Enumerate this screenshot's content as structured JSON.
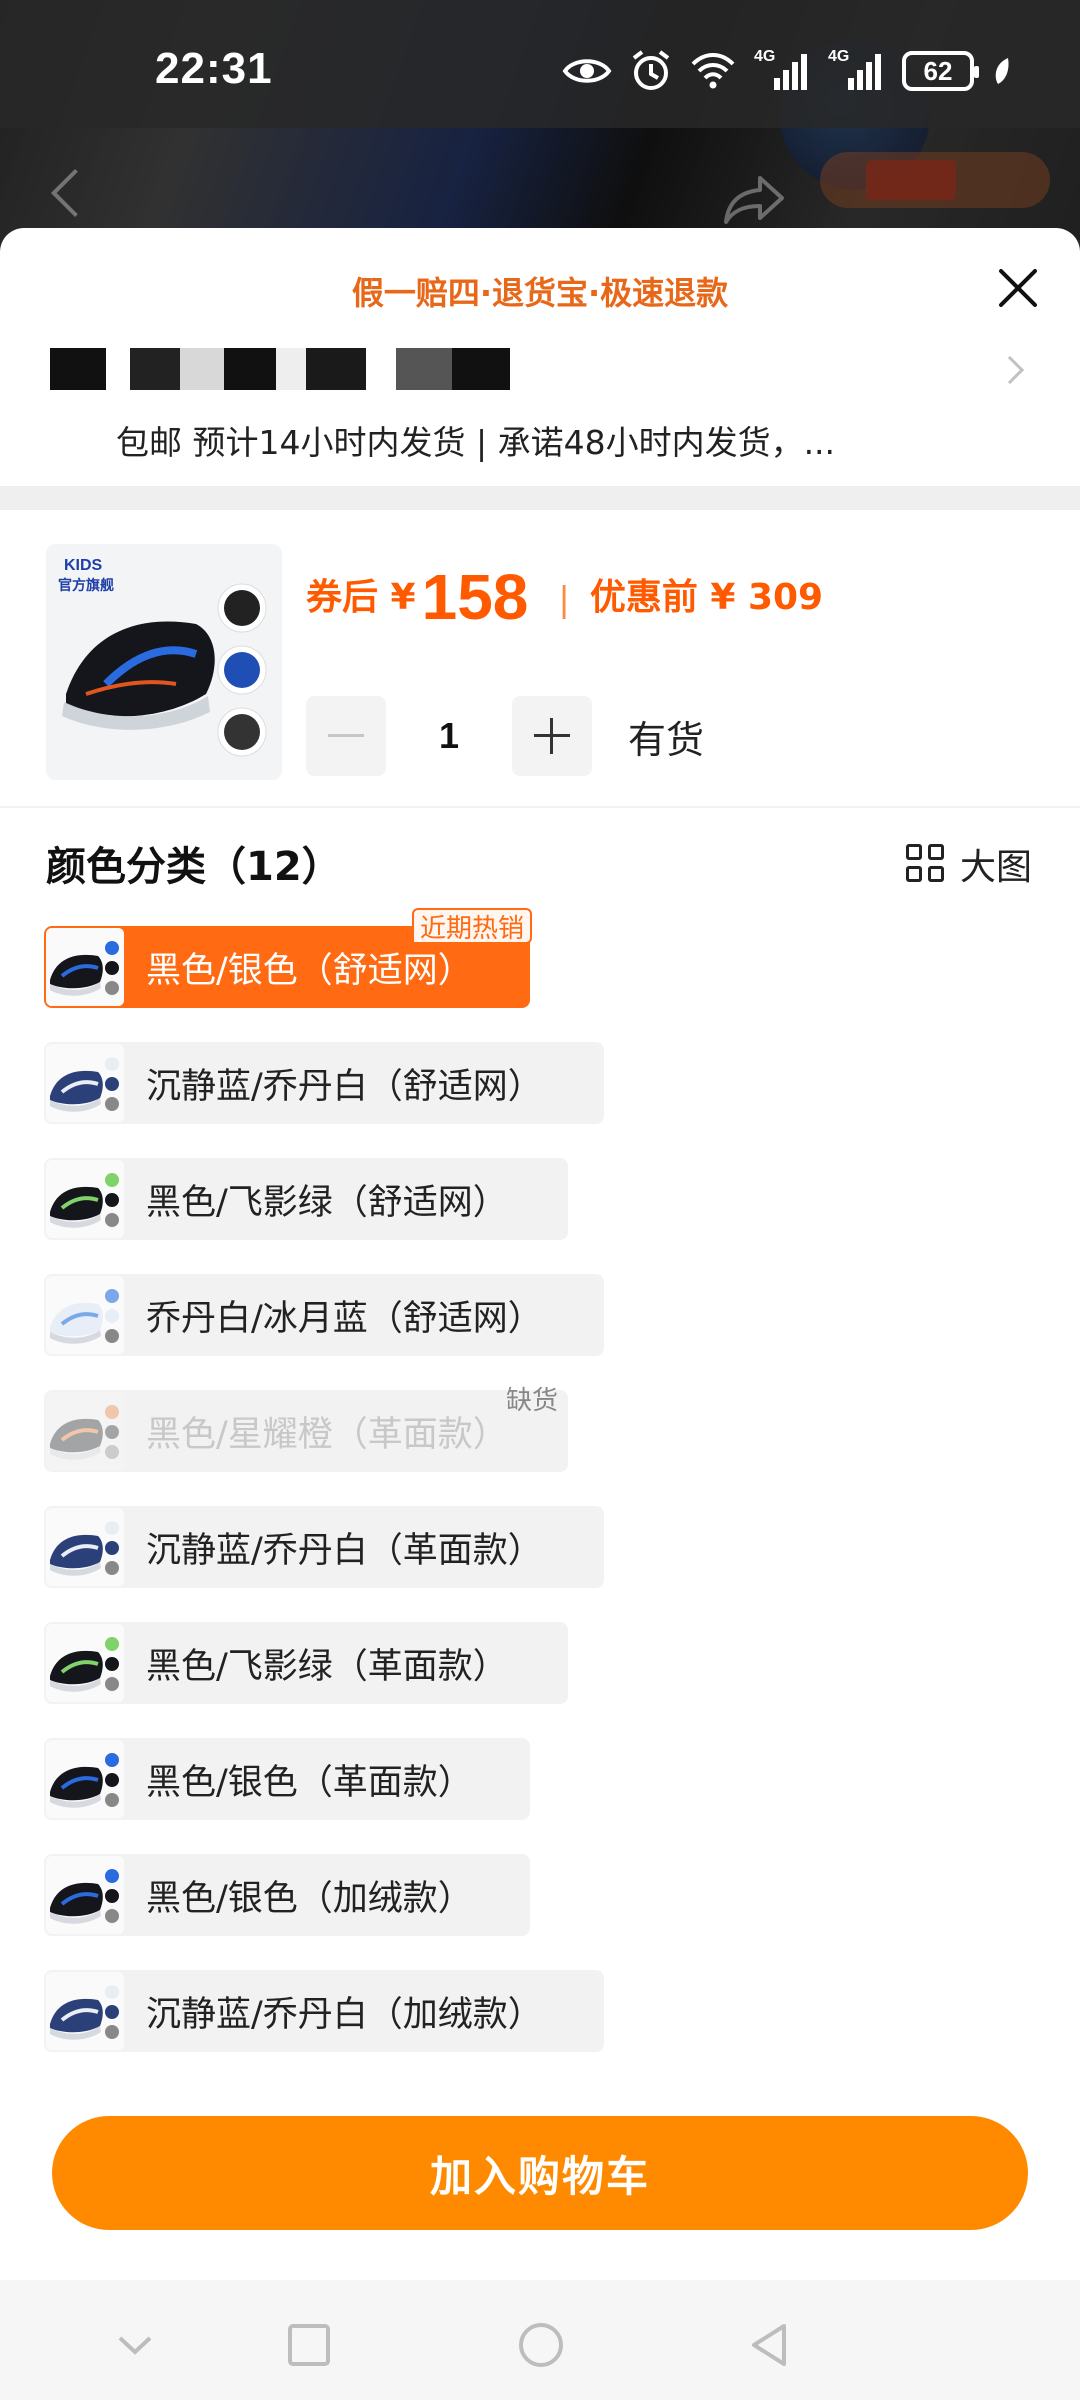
{
  "status_bar": {
    "time": "22:31",
    "battery": "62",
    "signal_1": "4G",
    "signal_2": "4G"
  },
  "sheet": {
    "guarantee_text": "假一赔四·退货宝·极速退款",
    "shipping_text": "包邮 预计14小时内发货 | 承诺48小时内发货，...",
    "price": {
      "coupon_prefix": "券后 ¥",
      "coupon_price": "158",
      "separator": "|",
      "before_label": "优惠前 ¥ 309"
    },
    "quantity": "1",
    "stock_status": "有货",
    "color_section_title": "颜色分类（12）",
    "big_view_label": "大图",
    "variants": [
      {
        "label": "黑色/银色（舒适网）",
        "tag": "近期热销",
        "state": "selected"
      },
      {
        "label": "沉静蓝/乔丹白（舒适网）",
        "state": "normal"
      },
      {
        "label": "黑色/飞影绿（舒适网）",
        "state": "normal"
      },
      {
        "label": "乔丹白/冰月蓝（舒适网）",
        "state": "normal"
      },
      {
        "label": "黑色/星耀橙（革面款）",
        "tag": "缺货",
        "state": "disabled"
      },
      {
        "label": "沉静蓝/乔丹白（革面款）",
        "state": "normal"
      },
      {
        "label": "黑色/飞影绿（革面款）",
        "state": "normal"
      },
      {
        "label": "黑色/银色（革面款）",
        "state": "normal"
      },
      {
        "label": "黑色/银色（加绒款）",
        "state": "normal"
      },
      {
        "label": "沉静蓝/乔丹白（加绒款）",
        "state": "normal"
      }
    ],
    "add_to_cart_label": "加入购物车",
    "thumbnail_brand": "KIDS",
    "thumbnail_store": "官方旗舰"
  },
  "colors": {
    "accent": "#ff6a12",
    "cta": "#ff8a00",
    "price": "#ff5a00",
    "guarantee": "#e8681a"
  }
}
